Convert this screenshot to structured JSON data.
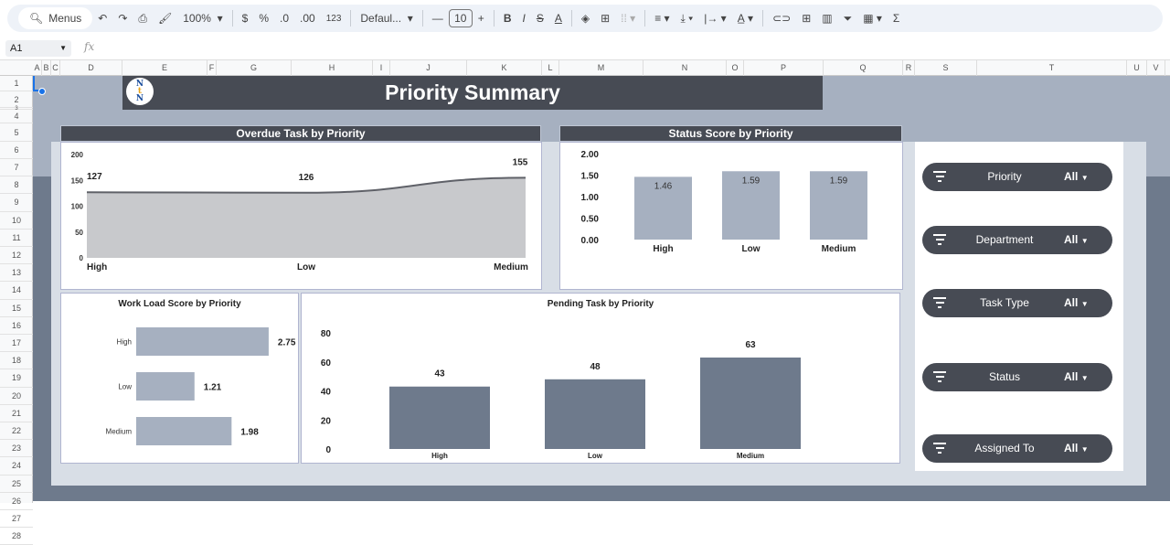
{
  "toolbar": {
    "menus": "Menus",
    "zoom": "100%",
    "currency": "$",
    "percent": "%",
    "dec_decrease": ".0",
    "dec_increase": ".00",
    "format_123": "123",
    "font": "Defaul...",
    "font_size": "10",
    "bold": "B",
    "italic": "I",
    "sum": "Σ"
  },
  "formula_bar": {
    "cell_ref": "A1",
    "fx": "fx"
  },
  "columns": [
    "A",
    "B",
    "C",
    "D",
    "E",
    "F",
    "G",
    "H",
    "I",
    "J",
    "K",
    "L",
    "M",
    "N",
    "O",
    "P",
    "Q",
    "R",
    "S",
    "T",
    "U",
    "V"
  ],
  "rows": [
    "1",
    "2",
    "3",
    "4",
    "5",
    "6",
    "7",
    "8",
    "9",
    "10",
    "11",
    "12",
    "13",
    "14",
    "15",
    "16",
    "17",
    "18",
    "19",
    "20",
    "21",
    "22",
    "23",
    "24",
    "25",
    "26",
    "27",
    "28"
  ],
  "dashboard": {
    "title": "Priority Summary",
    "logo_text": "NtN"
  },
  "colors": {
    "header": "#474b54",
    "bar_light": "#a6b0c0",
    "bar_dark": "#6e7a8c",
    "area": "#c8c9cc"
  },
  "filters": [
    {
      "label": "Priority",
      "value": "All"
    },
    {
      "label": "Department",
      "value": "All"
    },
    {
      "label": "Task Type",
      "value": "All"
    },
    {
      "label": "Status",
      "value": "All"
    },
    {
      "label": "Assigned To",
      "value": "All"
    }
  ],
  "chart_data": [
    {
      "type": "area",
      "title": "Overdue Task by Priority",
      "categories": [
        "High",
        "Low",
        "Medium"
      ],
      "values": [
        127,
        126,
        155
      ],
      "ylim": [
        0,
        200
      ],
      "yticks": [
        "0",
        "50",
        "100",
        "150",
        "200"
      ]
    },
    {
      "type": "bar",
      "title": "Status Score by Priority",
      "categories": [
        "High",
        "Low",
        "Medium"
      ],
      "values": [
        1.46,
        1.59,
        1.59
      ],
      "ylim": [
        0,
        2
      ],
      "yticks": [
        "0.00",
        "0.50",
        "1.00",
        "1.50",
        "2.00"
      ]
    },
    {
      "type": "bar",
      "orientation": "horizontal",
      "title": "Work Load Score by Priority",
      "categories": [
        "High",
        "Low",
        "Medium"
      ],
      "values": [
        2.75,
        1.21,
        1.98
      ]
    },
    {
      "type": "bar",
      "title": "Pending Task by Priority",
      "categories": [
        "High",
        "Low",
        "Medium"
      ],
      "values": [
        43,
        48,
        63
      ],
      "ylim": [
        0,
        80
      ],
      "yticks": [
        "0",
        "20",
        "40",
        "60",
        "80"
      ]
    }
  ]
}
